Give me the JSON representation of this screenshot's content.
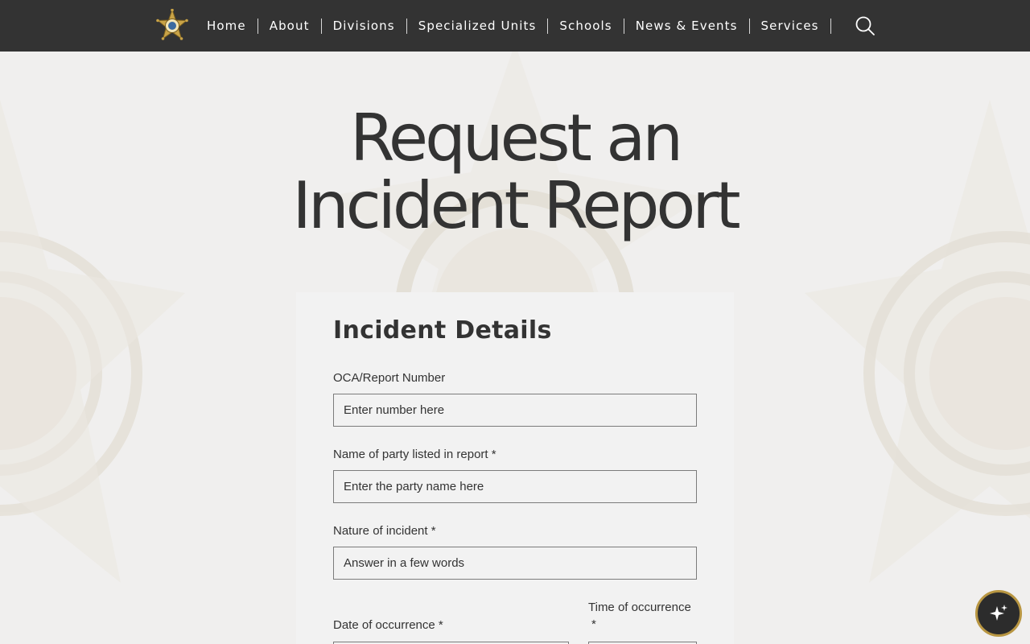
{
  "nav": {
    "items": [
      {
        "label": "Home"
      },
      {
        "label": "About"
      },
      {
        "label": "Divisions"
      },
      {
        "label": "Specialized Units"
      },
      {
        "label": "Schools"
      },
      {
        "label": "News & Events"
      },
      {
        "label": "Services"
      }
    ],
    "search_icon": "search-icon",
    "logo_icon": "sheriff-star-badge-icon"
  },
  "page": {
    "title_line1": "Request an",
    "title_line2": "Incident Report"
  },
  "form": {
    "section_title": "Incident Details",
    "fields": {
      "oca": {
        "label": "OCA/Report Number",
        "placeholder": "Enter number here"
      },
      "party": {
        "label": "Name of party listed in report *",
        "placeholder": "Enter the party name here"
      },
      "nature": {
        "label": "Nature of incident *",
        "placeholder": "Answer in a few words"
      },
      "date": {
        "label": "Date of occurrence *"
      },
      "time": {
        "label_line1": "Time of occurrence",
        "label_line2": "*"
      }
    }
  },
  "fab": {
    "icon": "sparkle-icon"
  },
  "colors": {
    "nav_bg": "#333333",
    "page_bg": "#f0efee",
    "text": "#333333",
    "accent_gold": "#b89642"
  }
}
